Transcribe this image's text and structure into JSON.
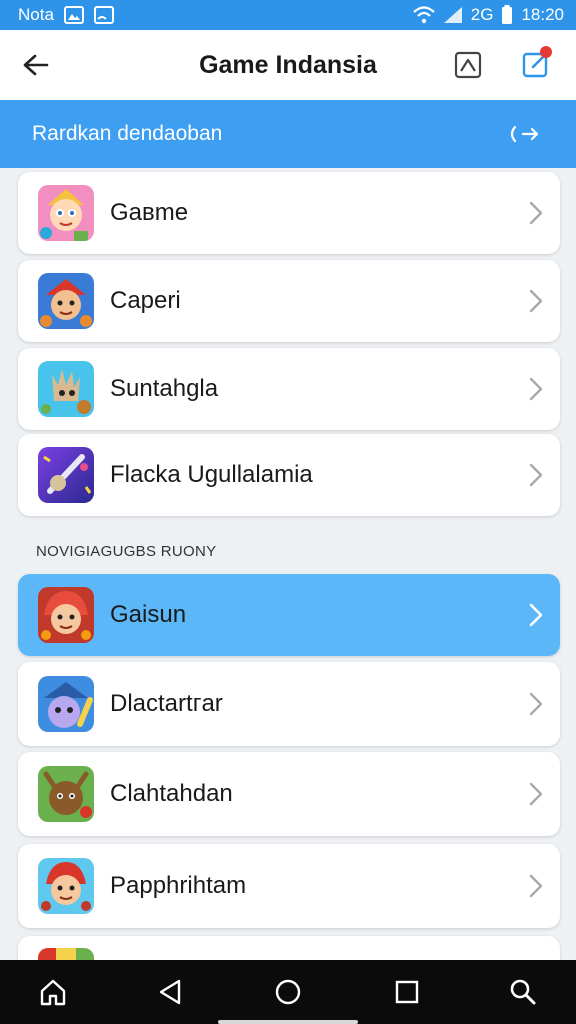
{
  "status_bar": {
    "carrier": "Nota",
    "network_label": "2G",
    "time": "18:20",
    "icons": [
      "image-icon",
      "cast-icon",
      "wifi-icon",
      "signal-icon",
      "battery-icon"
    ]
  },
  "app_bar": {
    "title": "Game Indansia",
    "back_icon": "arrow-left-icon",
    "actions": [
      "portrait-icon",
      "edit-square-icon"
    ]
  },
  "banner": {
    "text": "Rardkan dendaoban",
    "icon": "swap-arrows-icon"
  },
  "list_top": [
    {
      "name": "Gaвme",
      "icon": "game-avatar-pink"
    },
    {
      "name": "Caperi",
      "icon": "game-avatar-warrior"
    },
    {
      "name": "Suntahgla",
      "icon": "game-avatar-hand"
    },
    {
      "name": "Flacka Ugullalamia",
      "icon": "game-avatar-sword"
    }
  ],
  "section_label": "Novigiagugbs Ruony",
  "list_bottom": [
    {
      "name": "Gaisun",
      "icon": "game-avatar-redhair",
      "selected": true
    },
    {
      "name": "Dlactartгar",
      "icon": "game-avatar-wizard",
      "selected": false
    },
    {
      "name": "Clahtahdan",
      "icon": "game-avatar-moose",
      "selected": false
    },
    {
      "name": "Papphrihtam",
      "icon": "game-avatar-girl",
      "selected": false
    }
  ],
  "nav_bar": {
    "buttons": [
      "home-icon",
      "back-triangle-icon",
      "home-circle-icon",
      "recents-square-icon",
      "search-icon"
    ]
  },
  "colors": {
    "accent": "#2d94ea",
    "banner": "#3d9ef2",
    "selected_row": "#5cb7f8"
  }
}
